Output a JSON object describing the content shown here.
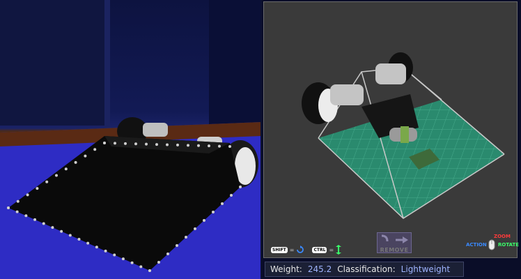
{
  "preview": {
    "view": "3d-preview"
  },
  "build": {
    "controls": {
      "shift_key": "SHIFT",
      "ctrl_key": "CTRL",
      "equals": "=",
      "remove_label": "REMOVE"
    },
    "mouse": {
      "zoom": "ZOOM",
      "action": "ACTION",
      "rotate": "ROTATE"
    },
    "icons": [
      "rotate-arrow-icon",
      "vertical-arrow-icon",
      "remove-arrow-icon",
      "mouse-icon"
    ]
  },
  "status": {
    "weight_label": "Weight:",
    "weight_value": "245.2",
    "classification_label": "Classification:",
    "classification_value": "Lightweight"
  },
  "colors": {
    "grid": "#2a8a6e",
    "value_text": "#9fb4ff",
    "zoom": "#ff3a3a",
    "action": "#3a8aff",
    "rotate": "#3aff6a"
  }
}
